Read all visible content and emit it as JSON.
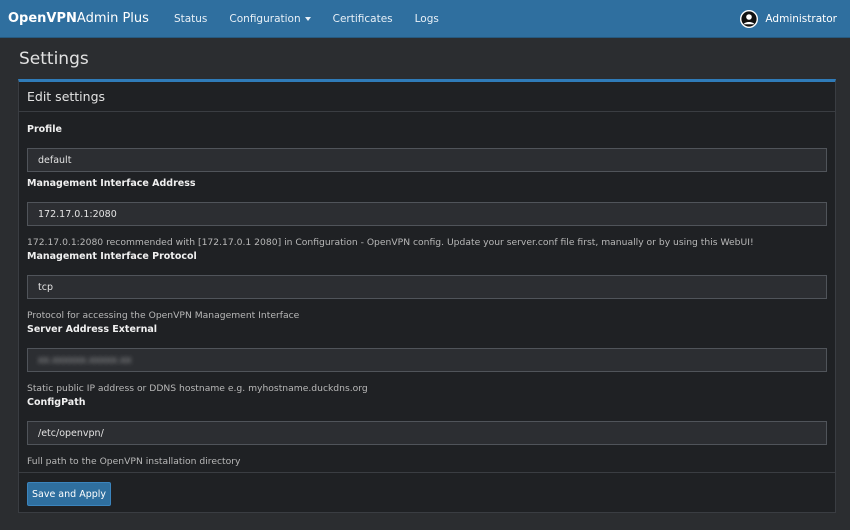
{
  "app": {
    "brand_bold": "OpenVPN",
    "brand_rest": "Admin Plus"
  },
  "nav": {
    "items": [
      {
        "label": "Status"
      },
      {
        "label": "Configuration"
      },
      {
        "label": "Certificates"
      },
      {
        "label": "Logs"
      }
    ],
    "user": "Administrator"
  },
  "page": {
    "title": "Settings"
  },
  "panel": {
    "title": "Edit settings",
    "fields": [
      {
        "label": "Profile",
        "value": "default",
        "help": ""
      },
      {
        "label": "Management Interface Address",
        "value": "172.17.0.1:2080",
        "help": "172.17.0.1:2080 recommended with [172.17.0.1 2080] in Configuration - OpenVPN config. Update your server.conf file first, manually or by using this WebUI!"
      },
      {
        "label": "Management Interface Protocol",
        "value": "tcp",
        "help": "Protocol for accessing the OpenVPN Management Interface"
      },
      {
        "label": "Server Address External",
        "value": "",
        "help": "Static public IP address or DDNS hostname e.g. myhostname.duckdns.org"
      },
      {
        "label": "ConfigPath",
        "value": "/etc/openvpn/",
        "help": "Full path to the OpenVPN installation directory"
      }
    ],
    "save_label": "Save and Apply"
  },
  "colors": {
    "navbar": "#2f6f9f",
    "accent": "#2f7bb8",
    "panel_bg": "#1f2124",
    "page_bg": "#2b2d30"
  },
  "icons": {
    "user": "user-avatar-icon",
    "dropdown": "caret-down-icon"
  }
}
